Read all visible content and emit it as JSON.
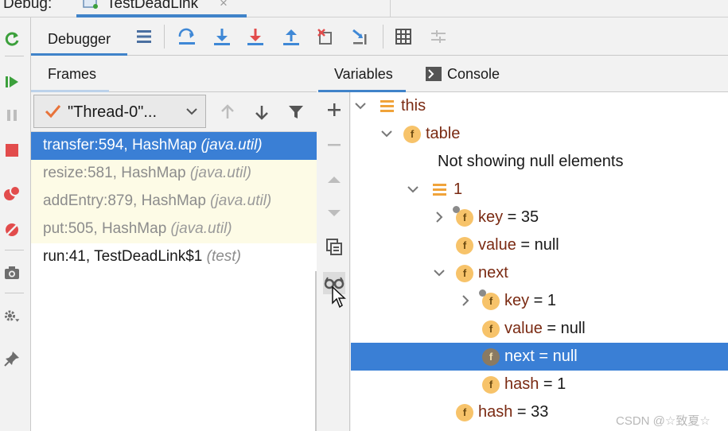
{
  "titlebar": {
    "debug_label": "Debug:",
    "run_tab_label": "TestDeadLink",
    "run_tab_close": "×"
  },
  "toolbar": {
    "debugger_tab": "Debugger",
    "icons": [
      "layout-icon",
      "step-over-icon",
      "step-into-icon",
      "force-step-into-icon",
      "step-out-icon",
      "drop-frame-icon",
      "run-to-cursor-icon",
      "evaluate-expression-icon",
      "trace-icon"
    ]
  },
  "frames": {
    "tab_label": "Frames",
    "thread_label": "\"Thread-0\"...",
    "rows": [
      {
        "method": "transfer:594, HashMap",
        "pkg": "(java.util)",
        "kind": "selected"
      },
      {
        "method": "resize:581, HashMap",
        "pkg": "(java.util)",
        "kind": "lib"
      },
      {
        "method": "addEntry:879, HashMap",
        "pkg": "(java.util)",
        "kind": "lib"
      },
      {
        "method": "put:505, HashMap",
        "pkg": "(java.util)",
        "kind": "lib"
      },
      {
        "method": "run:41, TestDeadLink$1",
        "pkg": "(test)",
        "kind": "user"
      }
    ]
  },
  "variables": {
    "tab_label": "Variables",
    "console_label": "Console",
    "rows": [
      {
        "icon": "lines",
        "chevron": "down",
        "name": "this",
        "value": ""
      },
      {
        "icon": "field",
        "chevron": "down",
        "name": "table",
        "value": ""
      },
      {
        "icon": "none",
        "chevron": "none",
        "name": "",
        "value": "Not showing null elements"
      },
      {
        "icon": "lines",
        "chevron": "down",
        "name": "1",
        "value": ""
      },
      {
        "icon": "field-locked",
        "chevron": "right",
        "name": "key",
        "value": " = 35"
      },
      {
        "icon": "field",
        "chevron": "none",
        "name": "value",
        "value": " = null"
      },
      {
        "icon": "field",
        "chevron": "down",
        "name": "next",
        "value": ""
      },
      {
        "icon": "field-locked",
        "chevron": "right",
        "name": "key",
        "value": " = 1"
      },
      {
        "icon": "field",
        "chevron": "none",
        "name": "value",
        "value": " = null"
      },
      {
        "icon": "field",
        "chevron": "none",
        "name": "next",
        "value": " = null",
        "selected": true
      },
      {
        "icon": "field",
        "chevron": "none",
        "name": "hash",
        "value": " = 1"
      },
      {
        "icon": "field",
        "chevron": "none",
        "name": "hash",
        "value": " = 33"
      }
    ]
  },
  "watermark": "CSDN @☆致夏☆",
  "colors": {
    "accent": "#3a7fd5",
    "library_frame_bg": "#fdfbe6",
    "field_icon": "#f7c36a"
  }
}
